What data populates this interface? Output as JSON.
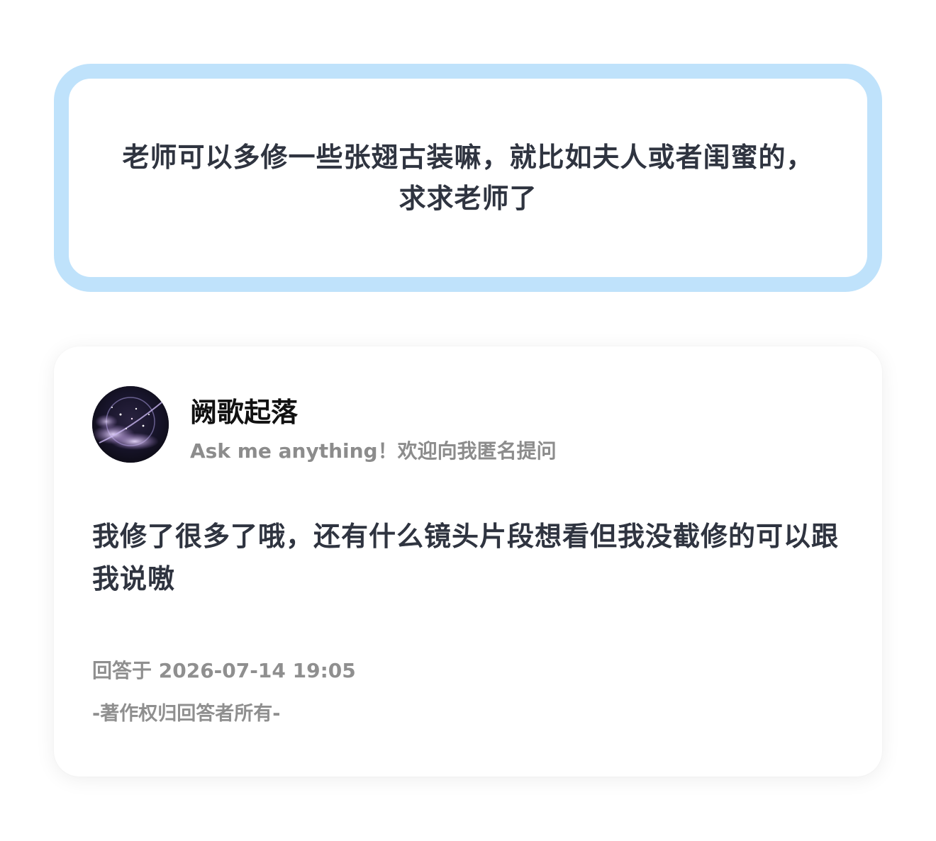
{
  "question": {
    "text": "老师可以多修一些张翅古装嘛，就比如夫人或者闺蜜的，求求老师了"
  },
  "answer": {
    "author_name": "阙歌起落",
    "author_bio": "Ask me anything！欢迎向我匿名提问",
    "avatar_icon": "galaxy-avatar",
    "body": "我修了很多了哦，还有什么镜头片段想看但我没截修的可以跟我说嗷",
    "answered_at": "回答于 2026-07-14 19:05",
    "copyright": "-著作权归回答者所有-"
  },
  "colors": {
    "question_border": "#bfe2fb",
    "text_primary": "#2f3440",
    "text_secondary": "#8c8c8c"
  }
}
